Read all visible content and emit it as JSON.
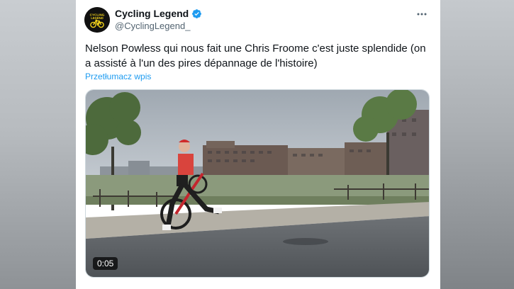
{
  "tweet": {
    "display_name": "Cycling Legend",
    "handle": "@CyclingLegend_",
    "verified": true,
    "avatar_text": "CYCLING LEGEND",
    "text": "Nelson Powless qui nous fait une Chris Froome c'est juste splendide (on a assisté à l'un des pires dépannage de l'histoire)",
    "translate_label": "Przetłumacz wpis",
    "more_icon": "more-dots-icon"
  },
  "video": {
    "duration": "0:05"
  },
  "colors": {
    "link": "#1d9bf0",
    "verified": "#1d9bf0",
    "text": "#0f1419",
    "muted": "#536471",
    "brand_yellow": "#f2d21b"
  }
}
